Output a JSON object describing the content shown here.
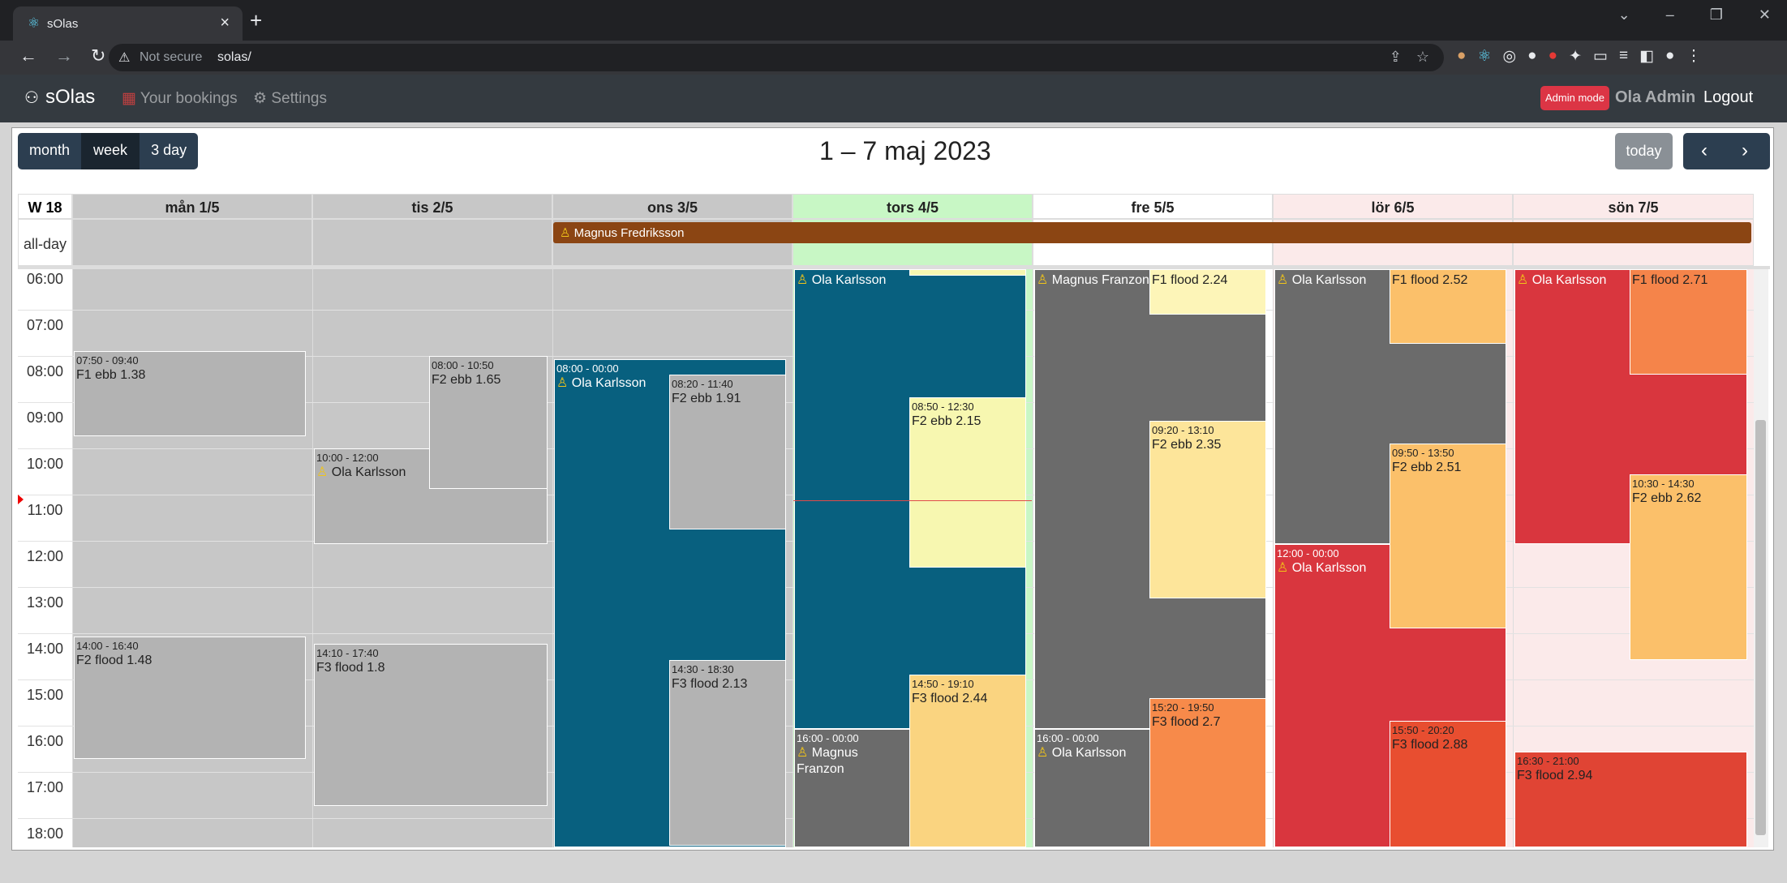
{
  "browser": {
    "tab_title": "sOlas",
    "address_warning": "Not secure",
    "url": "solas/"
  },
  "navbar": {
    "brand": "sOlas",
    "links": [
      "Your bookings",
      "Settings"
    ],
    "admin_badge": "Admin mode",
    "user_name": "Ola Admin",
    "logout": "Logout"
  },
  "calendar": {
    "views": [
      "month",
      "week",
      "3 day"
    ],
    "active_view": "3 day",
    "title": "1 – 7 maj 2023",
    "today_label": "today",
    "week_label": "W 18",
    "all_day_label": "all-day",
    "days": [
      "mån 1/5",
      "tis 2/5",
      "ons 3/5",
      "tors 4/5",
      "fre 5/5",
      "lör 6/5",
      "sön 7/5"
    ],
    "hours": [
      "06:00",
      "07:00",
      "08:00",
      "09:00",
      "10:00",
      "11:00",
      "12:00",
      "13:00",
      "14:00",
      "15:00",
      "16:00",
      "17:00",
      "18:00"
    ],
    "all_day_event": "Magnus Fredriksson",
    "events": {
      "mon_1": {
        "time": "07:50 - 09:40",
        "title": "F1 ebb 1.38"
      },
      "mon_2": {
        "time": "14:00 - 16:40",
        "title": "F2 flood 1.48"
      },
      "tue_1": {
        "time": "08:00 - 10:50",
        "title": "F2 ebb 1.65"
      },
      "tue_2": {
        "time": "10:00 - 12:00",
        "title": "Ola Karlsson"
      },
      "tue_3": {
        "time": "14:10 - 17:40",
        "title": "F3 flood 1.8"
      },
      "wed_1": {
        "time": "08:00 - 00:00",
        "title": "Ola Karlsson"
      },
      "wed_2": {
        "time": "08:20 - 11:40",
        "title": "F2 ebb 1.91"
      },
      "wed_3": {
        "time": "14:30 - 18:30",
        "title": "F3 flood 2.13"
      },
      "thu_1": {
        "title": "Ola Karlsson"
      },
      "thu_2": {
        "time": "08:50 - 12:30",
        "title": "F2 ebb 2.15"
      },
      "thu_3": {
        "time": "14:50 - 19:10",
        "title": "F3 flood 2.44"
      },
      "thu_4": {
        "time": "16:00 - 00:00",
        "title": "Magnus Franzon"
      },
      "fri_1": {
        "title": "Magnus Franzon"
      },
      "fri_2": {
        "title": "F1 flood 2.24"
      },
      "fri_3": {
        "time": "09:20 - 13:10",
        "title": "F2 ebb 2.35"
      },
      "fri_4": {
        "time": "15:20 - 19:50",
        "title": "F3 flood 2.7"
      },
      "fri_5": {
        "time": "16:00 - 00:00",
        "title": "Ola Karlsson"
      },
      "sat_1": {
        "title": "Ola Karlsson"
      },
      "sat_2": {
        "title": "F1 flood 2.52"
      },
      "sat_3": {
        "time": "09:50 - 13:50",
        "title": "F2 ebb 2.51"
      },
      "sat_4": {
        "time": "12:00 - 00:00",
        "title": "Ola Karlsson"
      },
      "sat_5": {
        "time": "15:50 - 20:20",
        "title": "F3 flood 2.88"
      },
      "sun_1": {
        "title": "Ola Karlsson"
      },
      "sun_2": {
        "title": "F1 flood 2.71"
      },
      "sun_3": {
        "time": "10:30 - 14:30",
        "title": "F2 ebb 2.62"
      },
      "sun_4": {
        "time": "16:30 - 21:00",
        "title": "F3 flood 2.94"
      }
    }
  }
}
